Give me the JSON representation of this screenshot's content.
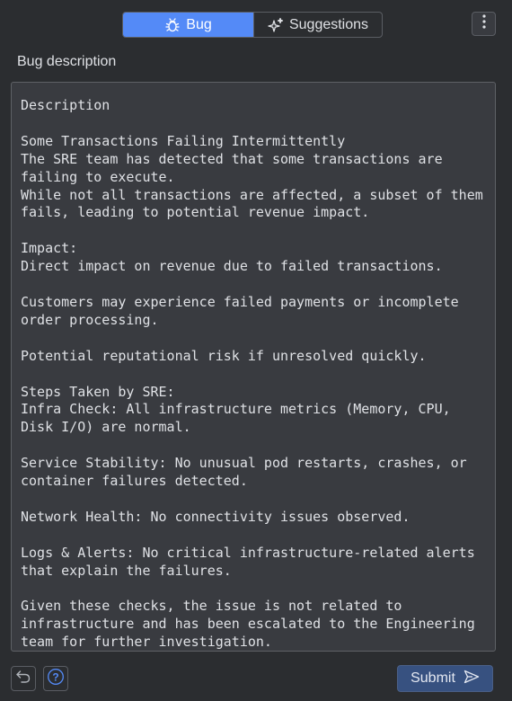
{
  "tabs": [
    {
      "label": "Bug",
      "icon": "bug-icon",
      "active": true
    },
    {
      "label": "Suggestions",
      "icon": "sparkle-icon",
      "active": false
    }
  ],
  "menu": {
    "icon": "more-vertical-icon"
  },
  "section_label": "Bug description",
  "description": {
    "text": "Description\n\nSome Transactions Failing Intermittently\nThe SRE team has detected that some transactions are failing to execute.\nWhile not all transactions are affected, a subset of them fails, leading to potential revenue impact.\n\nImpact:\nDirect impact on revenue due to failed transactions.\n\nCustomers may experience failed payments or incomplete order processing.\n\nPotential reputational risk if unresolved quickly.\n\nSteps Taken by SRE:\nInfra Check: All infrastructure metrics (Memory, CPU, Disk I/O) are normal.\n\nService Stability: No unusual pod restarts, crashes, or container failures detected.\n\nNetwork Health: No connectivity issues observed.\n\nLogs & Alerts: No critical infrastructure-related alerts that explain the failures.\n\nGiven these checks, the issue is not related to infrastructure and has been escalated to the Engineering team for further investigation."
  },
  "footer": {
    "undo_icon": "undo-icon",
    "help_icon": "help-icon",
    "submit_label": "Submit",
    "submit_icon": "send-icon"
  },
  "colors": {
    "background": "#2b2d30",
    "accent": "#548af7",
    "submit_bg": "#375180",
    "field_bg": "#393b40"
  }
}
